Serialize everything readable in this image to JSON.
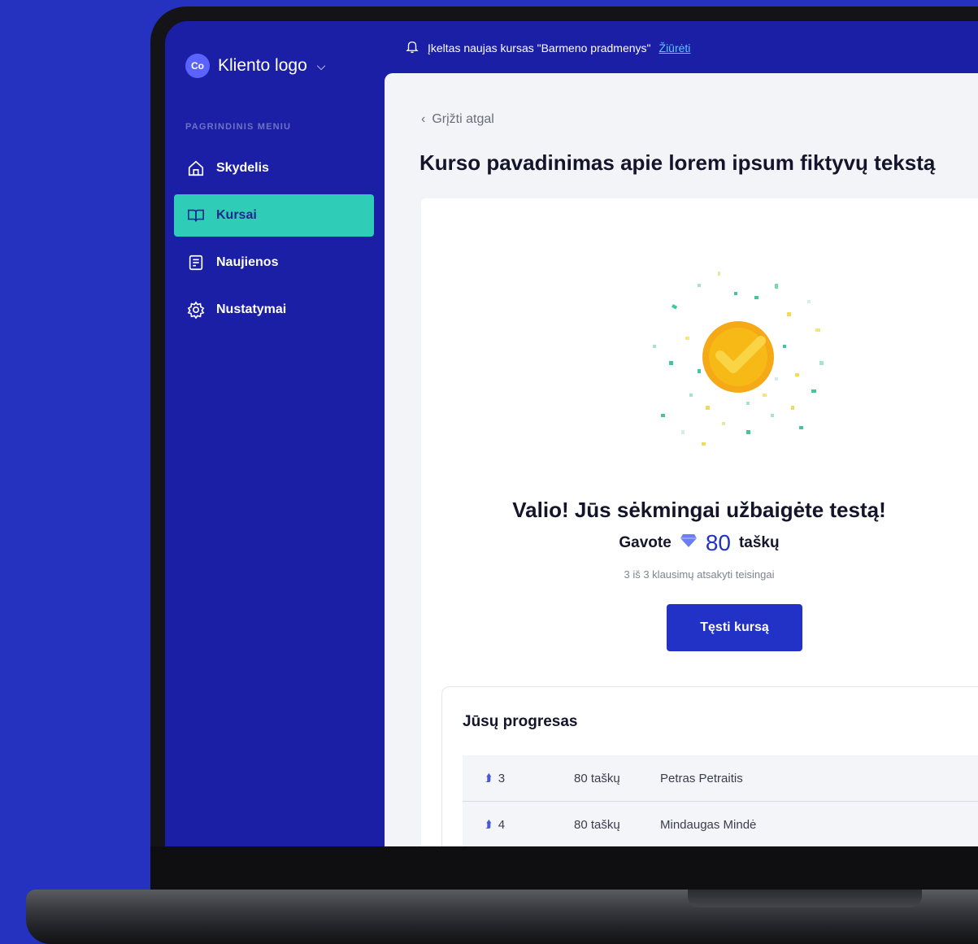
{
  "sidebar": {
    "brand": {
      "mark": "Co",
      "label": "Kliento logo"
    },
    "menu_heading": "PAGRINDINIS MENIU",
    "items": [
      {
        "label": "Skydelis",
        "icon": "home-icon",
        "active": false
      },
      {
        "label": "Kursai",
        "icon": "book-icon",
        "active": true
      },
      {
        "label": "Naujienos",
        "icon": "news-icon",
        "active": false
      },
      {
        "label": "Nustatymai",
        "icon": "gear-icon",
        "active": false
      }
    ]
  },
  "notification": {
    "text": "Įkeltas naujas kursas \"Barmeno pradmenys\"",
    "link": "Žiūrėti"
  },
  "main": {
    "back_label": "Grįžti atgal",
    "title": "Kurso pavadinimas apie lorem ipsum fiktyvų tekstą",
    "success_title": "Valio! Jūs sėkmingai užbaigėte testą!",
    "points_prefix": "Gavote",
    "points_value": "80",
    "points_suffix": "taškų",
    "correct_text": "3 iš 3 klausimų atsakyti teisingai",
    "continue_button": "Tęsti kursą"
  },
  "progress": {
    "title": "Jūsų progresas",
    "rows": [
      {
        "rank": "3",
        "points": "80 taškų",
        "name": "Petras Petraitis"
      },
      {
        "rank": "4",
        "points": "80 taškų",
        "name": "Mindaugas Mindė"
      }
    ]
  },
  "colors": {
    "background": "#2531bf",
    "sidebar": "#1b1fa6",
    "active_item": "#2fcdb8",
    "primary": "#2231c6",
    "badge": "#f7b916"
  }
}
